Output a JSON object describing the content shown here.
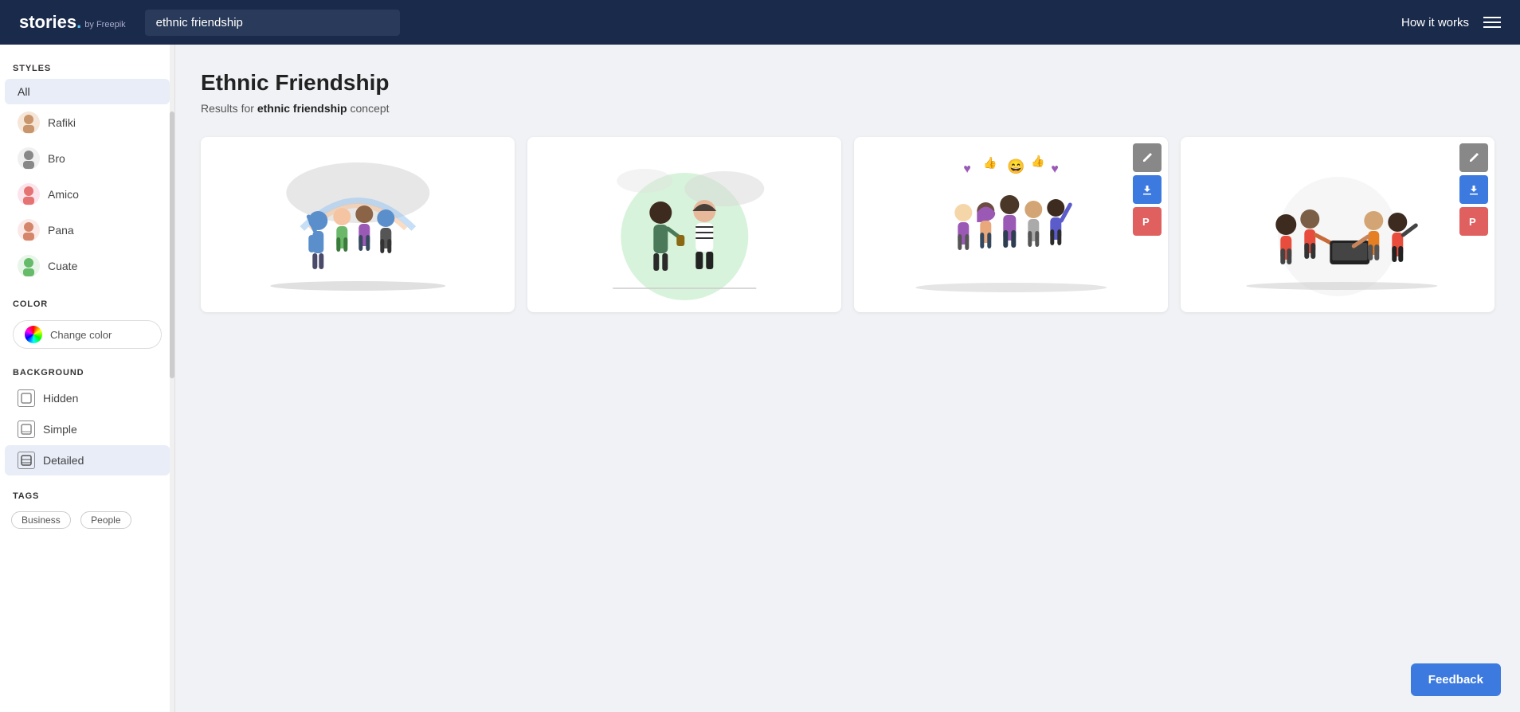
{
  "header": {
    "logo_text": "stories",
    "logo_sub": "by Freepik",
    "search_value": "ethnic friendship",
    "how_it_works": "How it works"
  },
  "sidebar": {
    "styles_label": "STYLES",
    "color_label": "COLOR",
    "background_label": "BACKGROUND",
    "tags_label": "TAGS",
    "styles": [
      {
        "id": "all",
        "label": "All",
        "active": true,
        "avatar": null
      },
      {
        "id": "rafiki",
        "label": "Rafiki",
        "active": false,
        "avatar": "👤"
      },
      {
        "id": "bro",
        "label": "Bro",
        "active": false,
        "avatar": "👥"
      },
      {
        "id": "amico",
        "label": "Amico",
        "active": false,
        "avatar": "👤"
      },
      {
        "id": "pana",
        "label": "Pana",
        "active": false,
        "avatar": "👤"
      },
      {
        "id": "cuate",
        "label": "Cuate",
        "active": false,
        "avatar": "👤"
      }
    ],
    "color_btn": "Change color",
    "backgrounds": [
      {
        "id": "hidden",
        "label": "Hidden",
        "active": false
      },
      {
        "id": "simple",
        "label": "Simple",
        "active": false
      },
      {
        "id": "detailed",
        "label": "Detailed",
        "active": true
      }
    ],
    "tags": [
      "Business",
      "People"
    ]
  },
  "content": {
    "page_title": "Ethnic Friendship",
    "results_prefix": "Results for ",
    "results_keyword": "ethnic friendship",
    "results_suffix": " concept"
  },
  "feedback": {
    "label": "Feedback"
  }
}
